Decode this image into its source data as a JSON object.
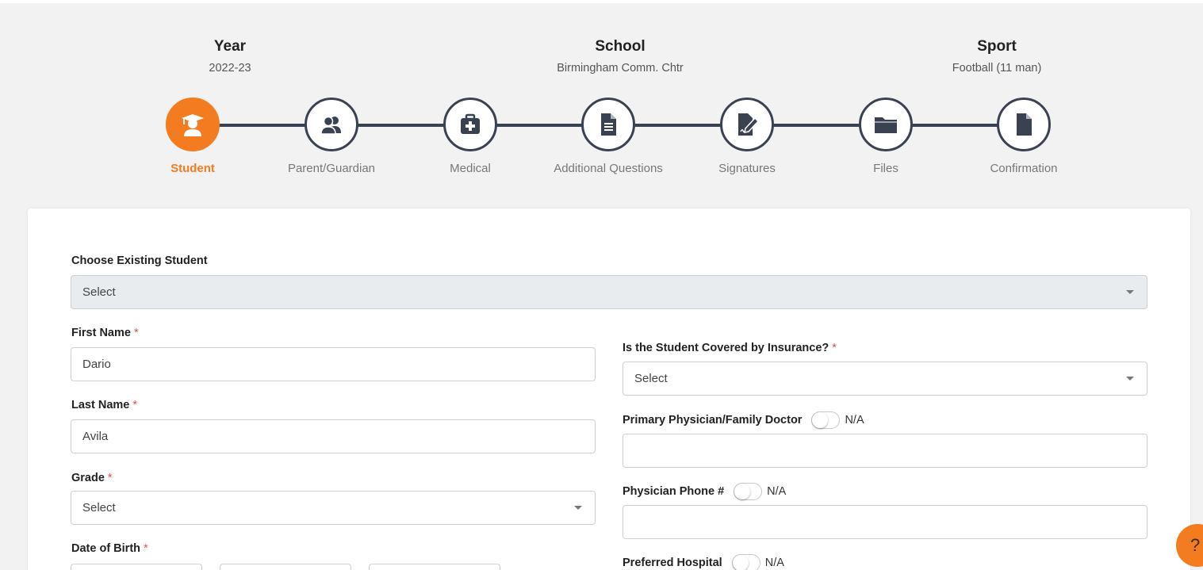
{
  "header": {
    "year": {
      "label": "Year",
      "value": "2022-23"
    },
    "school": {
      "label": "School",
      "value": "Birmingham Comm. Chtr"
    },
    "sport": {
      "label": "Sport",
      "value": "Football (11 man)"
    }
  },
  "steps": [
    {
      "label": "Student",
      "icon": "graduate-student-icon",
      "active": true
    },
    {
      "label": "Parent/Guardian",
      "icon": "users-icon",
      "active": false
    },
    {
      "label": "Medical",
      "icon": "medical-kit-icon",
      "active": false
    },
    {
      "label": "Additional Questions",
      "icon": "document-icon",
      "active": false
    },
    {
      "label": "Signatures",
      "icon": "signature-icon",
      "active": false
    },
    {
      "label": "Files",
      "icon": "folder-icon",
      "active": false
    },
    {
      "label": "Confirmation",
      "icon": "file-icon",
      "active": false
    }
  ],
  "colors": {
    "accent": "#f47c20",
    "step_dark": "#3a4150",
    "required": "#d9534f"
  },
  "form": {
    "existing_student": {
      "label": "Choose Existing Student",
      "value": "Select"
    },
    "first_name": {
      "label": "First Name",
      "value": "Dario"
    },
    "last_name": {
      "label": "Last Name",
      "value": "Avila"
    },
    "grade": {
      "label": "Grade",
      "value": "Select"
    },
    "dob": {
      "label": "Date of Birth"
    },
    "required_mark": "*",
    "insurance": {
      "label": "Is the Student Covered by Insurance?",
      "value": "Select"
    },
    "physician": {
      "label": "Primary Physician/Family Doctor",
      "na": "N/A",
      "value": ""
    },
    "physician_phone": {
      "label": "Physician Phone #",
      "na": "N/A",
      "value": ""
    },
    "hospital": {
      "label": "Preferred Hospital",
      "na": "N/A"
    }
  },
  "help": {
    "icon": "help-icon",
    "glyph": "?"
  }
}
